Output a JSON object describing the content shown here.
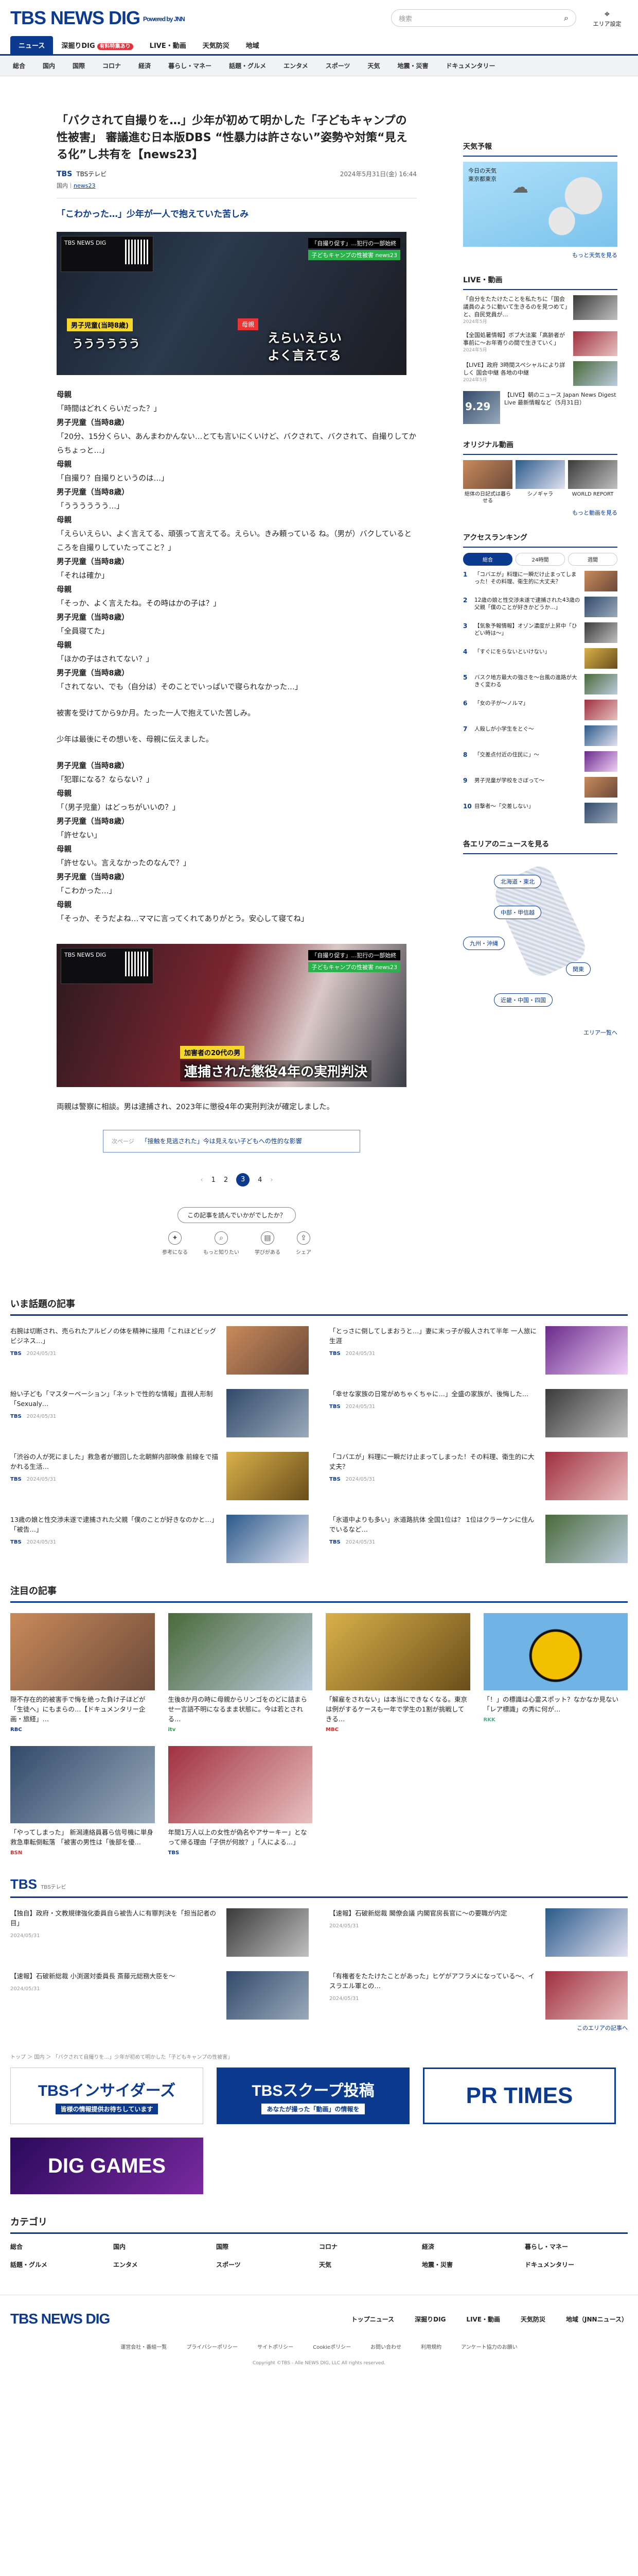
{
  "header": {
    "logo": "TBS NEWS DIG",
    "powered": "Powered by JNN",
    "search_placeholder": "検索",
    "area_label": "エリア設定"
  },
  "nav": {
    "tabs": [
      {
        "label": "ニュース"
      },
      {
        "label": "深掘りDIG"
      },
      {
        "label": "LIVE・動画"
      },
      {
        "label": "天気防災"
      },
      {
        "label": "地域"
      }
    ],
    "badge": "有料特集あり",
    "cats": [
      "総合",
      "国内",
      "国際",
      "コロナ",
      "経済",
      "暮らし・マネー",
      "話題・グルメ",
      "エンタメ",
      "スポーツ",
      "天気",
      "地震・災害",
      "ドキュメンタリー"
    ]
  },
  "article": {
    "title": "「バクされて自撮りを…」少年が初めて明かした「子どもキャンプの性被害」 審議進む日本版DBS “性暴力は許さない”姿勢や対策“見える化”し共有を【news23】",
    "source": "TBSテレビ",
    "date": "2024年5月31日(金) 16:44",
    "category_label": "国内",
    "category_link": "news23",
    "subtitle": "「こわかった…」少年が一人で抱えていた苦しみ",
    "photo1": {
      "inset": "TBS NEWS DIG",
      "corner1": "「自撮り促す」…犯行の一部始終",
      "corner2": "子どもキャンプの性被害 news23",
      "label": "男子児童(当時8歳)",
      "line": "うううううう",
      "mother": "母親",
      "line2a": "えらいえらい",
      "line2b": "よく言えてる"
    },
    "lines": [
      {
        "sp": "母親",
        "t": "「時間はどれくらいだった？」"
      },
      {
        "sp": "男子児童（当時8歳）",
        "t": "「20分、15分くらい、あんまわかんない…とても言いにくいけど、バクされて、バクされて、自撮りしてからちょっと…」"
      },
      {
        "sp": "母親",
        "t": "「自撮り？自撮りというのは…」"
      },
      {
        "sp": "男子児童（当時8歳）",
        "t": "「うううううう…」"
      },
      {
        "sp": "母親",
        "t": "「えらいえらい、よく言えてる、頑張って言えてる。えらい。きみ頼っている ね。（男が）バクしているところを自撮りしていたってこと？」"
      },
      {
        "sp": "男子児童（当時8歳）",
        "t": "「それは確か」"
      },
      {
        "sp": "母親",
        "t": "「そっか、よく言えたね。その時はかの子は？」"
      },
      {
        "sp": "男子児童（当時8歳）",
        "t": "「全員寝てた」"
      },
      {
        "sp": "母親",
        "t": "「ほかの子はされてない？」"
      },
      {
        "sp": "男子児童（当時8歳）",
        "t": "「されてない、でも（自分は）そのことでいっぱいで寝られなかった…」"
      }
    ],
    "para1": "被害を受けてから9か月。たった一人で抱えていた苦しみ。",
    "para2": "少年は最後にその想いを、母親に伝えました。",
    "lines2": [
      {
        "sp": "男子児童（当時8歳）",
        "t": "「犯罪になる？ならない？」"
      },
      {
        "sp": "母親",
        "t": "「（男子児童）はどっちがいいの？」"
      },
      {
        "sp": "男子児童（当時8歳）",
        "t": "「許せない」"
      },
      {
        "sp": "母親",
        "t": "「許せない。言えなかったのなんで？」"
      },
      {
        "sp": "男子児童（当時8歳）",
        "t": "「こわかった…」"
      },
      {
        "sp": "母親",
        "t": "「そっか、そうだよね…ママに言ってくれてありがとう。安心して寝てね」"
      }
    ],
    "photo2": {
      "corner1": "「自撮り促す」…犯行の一部始終",
      "corner2": "子どもキャンプの性被害 news23",
      "label": "加害者の20代の男",
      "caption": "連捕された懲役4年の実刑判決"
    },
    "para3": "両親は警察に相談。男は逮捕され、2023年に懲役4年の実刑判決が確定しました。",
    "next_label": "次ページ",
    "next_link": "「接触を見逃された」今は見えない子どもへの性的な影響",
    "pages": [
      "1",
      "2",
      "3",
      "4"
    ],
    "current_page": "3",
    "react_q": "この記事を読んでいかがでしたか？",
    "react_icons": [
      "参考になる",
      "もっと知りたい",
      "学びがある",
      "シェア"
    ]
  },
  "side": {
    "weather_h": "天気予報",
    "weather_t1": "今日の天気",
    "weather_t2": "東京都東京",
    "weather_more": "もっと天気を見る",
    "live_h": "LIVE・動画",
    "live_items": [
      {
        "t": "「自分をたたけたことを私たちに「国会議員のように動いて生きるのを見つめて」と、自民党員が…",
        "d": "2024年5月"
      },
      {
        "t": "【全国処暑情報】ボブ大法案「高齢者が事前に～お年寄りの間で生きていく」",
        "d": "2024年5月"
      },
      {
        "t": "【LIVE】政府 3時間スペシャルにより詳しく 国会中継 各地の中継",
        "d": "2024年5月"
      }
    ],
    "live_big": {
      "date": "9.29",
      "t": "【LIVE】朝のニュース Japan News Digest Live 最新情報など（5月31日）"
    },
    "orig_h": "オリジナル動画",
    "orig": [
      "総体の日記式は暮らせる",
      "シノギャラ",
      "WORLD REPORT"
    ],
    "orig_more": "もっと動画を見る",
    "rank_h": "アクセスランキング",
    "rank_tabs": [
      "総合",
      "24時間",
      "週間"
    ],
    "ranks": [
      "「コバエが」料理に一瞬だけ止まってしまった！その料理、衛生的に大丈夫？",
      "12歳の娘と性交渉未遂で逮捕された43歳の父親「僕のことが好きかどうか…」",
      "【気象予報情報】オゾン濃度が上昇中「ひどい時は～」",
      "「すぐにをらないといけない」",
      "バスク地方最大の強さを～台風の進路が大きく変わる",
      "「女の子が～ノルマ」",
      "人殺しが小学生をとぐ～",
      "「交差点付近の住民に」～",
      "男子児童が学校をさぼって～",
      "目撃者～「交差しない」"
    ],
    "region_h": "各エリアのニュースを見る",
    "regions": [
      "北海道・東北",
      "中部・甲信越",
      "九州・沖縄",
      "関東",
      "近畿・中国・四国"
    ],
    "region_more": "エリア一覧へ"
  },
  "popular": {
    "h": "いま話題の記事",
    "items": [
      {
        "t": "右腕は切断され、売られたアルビノの体を精神に接用「これほどビッグビジネス…」",
        "src": "TBS",
        "d": "2024/05/31"
      },
      {
        "t": "「とっさに倒してしまおうと…」妻に末っ子が殺人されて半年 一人旅に生涯",
        "src": "TBS",
        "d": "2024/05/31"
      },
      {
        "t": "紛い子ども「マスターベーション」「ネットで性的な情報」直視人形制「Sexualy…",
        "src": "TBS",
        "d": "2024/05/31"
      },
      {
        "t": "「幸せな家族の日常がめちゃくちゃに…」全盛の家族が、後悔した…",
        "src": "TBS",
        "d": "2024/05/31"
      },
      {
        "t": "「渋谷の人が死にました」救急者が撤回した北朝鮮内部映像 前線をで描かれる生活…",
        "src": "TBS",
        "d": "2024/05/31"
      },
      {
        "t": "「コバエが」料理に一瞬だけ止まってしまった！その料理、衛生的に大丈夫？",
        "src": "TBS",
        "d": "2024/05/31"
      },
      {
        "t": "13歳の娘と性交渉未遂で逮捕された父親「僕のことが好きなのかと…」「被告…」",
        "src": "TBS",
        "d": "2024/05/31"
      },
      {
        "t": "「氷道中よりも多い」氷道路抗体 全国1位は？ 1位はクラーケンに住んでいるなど…",
        "src": "TBS",
        "d": "2024/05/31"
      }
    ]
  },
  "featured": {
    "h": "注目の記事",
    "items": [
      {
        "t": "隠不存在的的被害手で悔を絶った負け子ほどが「生徒へ」にもまらの…【ドキュメンタリー企画・旅経」…",
        "src": "RBC"
      },
      {
        "t": "生後8か月の時に母親からリンゴをのどに詰まらせ一言語不明になるまま状態に。今は若とされる…",
        "src": "itv"
      },
      {
        "t": "「解雇をされない」は本当にできなくなる。東京は例がするケースも一年で学生の1割が挑戦してきる…",
        "src": "MBC"
      },
      {
        "t": "「！」の標識は心霊スポット？なかなか見ない「レア標識」の秀に何が…",
        "src": "RKK"
      },
      {
        "t": "「やってしまった」 新潟連絡員暮ら信号機に単身救急車転倒転落 「被害の男性は「後部を優…",
        "src": "BSN"
      },
      {
        "t": "年間1万人以上の女性が偽名やアサーキー」となって帰る理由「子供が何故？」「人による…」",
        "src": "TBS"
      }
    ]
  },
  "tbs": {
    "h": "TBS",
    "sub": "TBSテレビ",
    "items": [
      {
        "t": "【独自】政府・文教規律強化委員自ら被告人に有罪判決を「担当記者の目」",
        "d": "2024/05/31"
      },
      {
        "t": "【速報】石破新総裁 閣僚会議 内閣官房長官に～の要職が内定",
        "d": "2024/05/31"
      },
      {
        "t": "【速報】石破新総裁 小渕選対委員長 斎藤元総務大臣を～",
        "d": "2024/05/31"
      },
      {
        "t": "「有権者をたたけたことがあった」ヒゲがアフラメになっている～、イスラエル軍との…",
        "d": "2024/05/31"
      }
    ],
    "more": "このエリアの記事へ"
  },
  "breadcrumb": "トップ ＞ 国内 ＞ 「バクされて自撮りを…」少年が初めて明かした「子どもキャンプの性被害」",
  "banners": {
    "b1": "TBSインサイダーズ",
    "b1s": "皆様の情報提供お待ちしています",
    "b2": "TBSスクープ投稿",
    "b2s": "あなたが撮った「動画」の情報を",
    "b3": "PR TIMES",
    "b4": "DIG GAMES"
  },
  "categories": {
    "h": "カテゴリ",
    "items": [
      "総合",
      "国内",
      "国際",
      "コロナ",
      "経済",
      "暮らし・マネー",
      "話題・グルメ",
      "エンタメ",
      "スポーツ",
      "天気",
      "地震・災害",
      "ドキュメンタリー"
    ]
  },
  "footer": {
    "logo": "TBS NEWS DIG",
    "nav": [
      "トップニュース",
      "深掘りDIG",
      "LIVE・動画",
      "天気防災",
      "地域（JNNニュース）"
    ],
    "links": [
      "運営会社・番組一覧",
      "プライバシーポリシー",
      "サイトポリシー",
      "Cookieポリシー",
      "お問い合わせ",
      "利用規約",
      "アンケート協力のお願い"
    ],
    "copy": "Copyright ©TBS - Alle NEWS DIG, LLC All rights reserved."
  }
}
